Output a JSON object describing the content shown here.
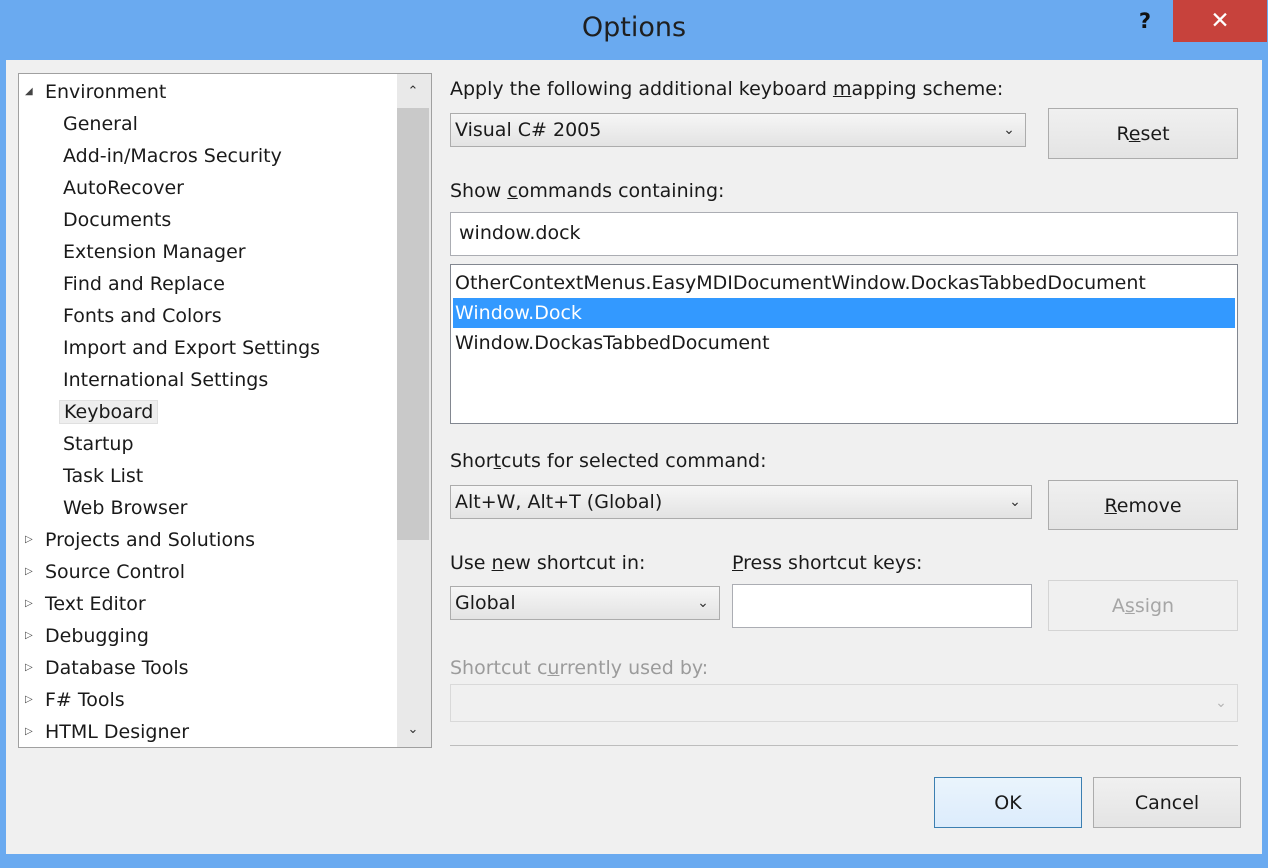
{
  "window": {
    "title": "Options",
    "help_label": "?",
    "close_label": "✕"
  },
  "tree": {
    "environment": "Environment",
    "items": [
      "General",
      "Add-in/Macros Security",
      "AutoRecover",
      "Documents",
      "Extension Manager",
      "Find and Replace",
      "Fonts and Colors",
      "Import and Export Settings",
      "International Settings",
      "Keyboard",
      "Startup",
      "Task List",
      "Web Browser"
    ],
    "selected": "Keyboard",
    "categories": [
      "Projects and Solutions",
      "Source Control",
      "Text Editor",
      "Debugging",
      "Database Tools",
      "F# Tools",
      "HTML Designer"
    ],
    "expanded_glyph": "◢",
    "collapsed_glyph": "▷",
    "scroll_up": "⌃",
    "scroll_down": "⌄"
  },
  "keyboard": {
    "mapping_label_a": "Apply the following additional keyboard ",
    "mapping_label_u": "m",
    "mapping_label_b": "apping scheme:",
    "mapping_value": "Visual C# 2005",
    "reset_a": "R",
    "reset_u": "e",
    "reset_b": "set",
    "show_label_a": "Show ",
    "show_label_u": "c",
    "show_label_b": "ommands containing:",
    "search_value": "window.dock",
    "commands": [
      "OtherContextMenus.EasyMDIDocumentWindow.DockasTabbedDocument",
      "Window.Dock",
      "Window.DockasTabbedDocument"
    ],
    "selected_command": "Window.Dock",
    "shortcuts_label_a": "Shor",
    "shortcuts_label_u": "t",
    "shortcuts_label_b": "cuts for selected command:",
    "shortcuts_value": "Alt+W, Alt+T (Global)",
    "remove_u": "R",
    "remove_b": "emove",
    "use_label_a": "Use ",
    "use_label_u": "n",
    "use_label_b": "ew shortcut in:",
    "use_value": "Global",
    "press_label_u": "P",
    "press_label_b": "ress shortcut keys:",
    "press_value": "",
    "assign_label_a": "A",
    "assign_label_u": "s",
    "assign_label_b": "sign",
    "used_by_label_a": "Shortcut c",
    "used_by_label_u": "u",
    "used_by_label_b": "rrently used by:",
    "used_by_value": ""
  },
  "footer": {
    "ok": "OK",
    "cancel": "Cancel"
  }
}
